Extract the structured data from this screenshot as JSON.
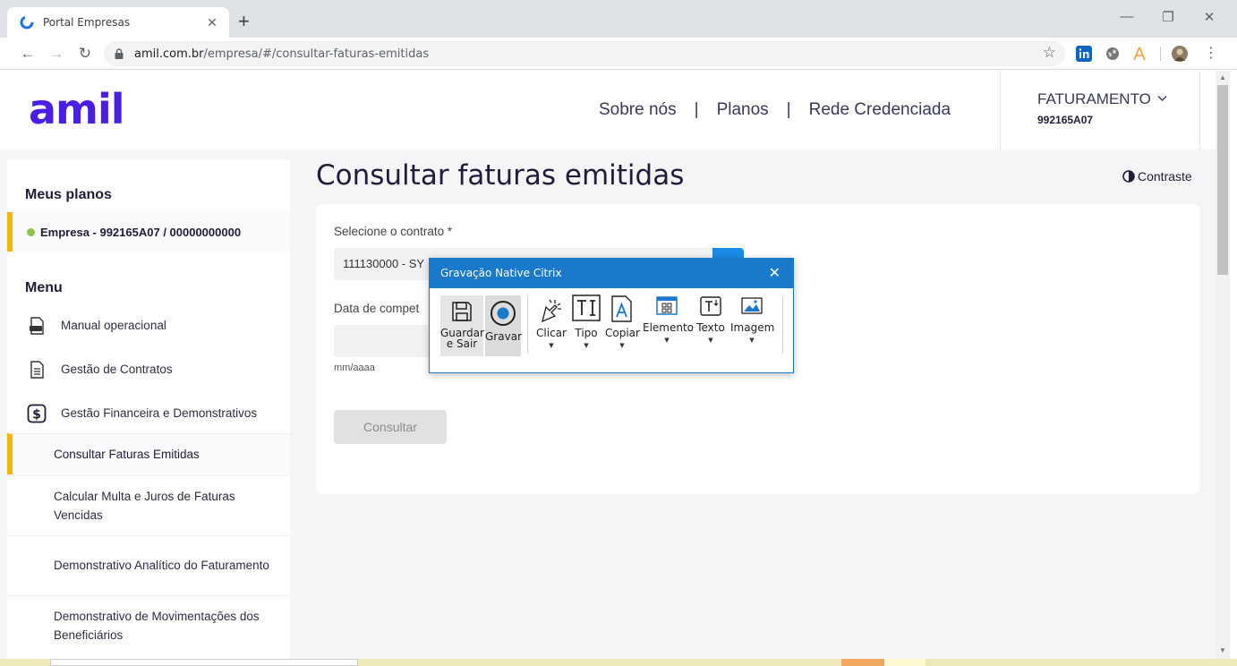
{
  "browser": {
    "tab_title": "Portal Empresas",
    "tab_close": "✕",
    "new_tab": "+",
    "url_host": "amil.com.br",
    "url_path": "/empresa/#/consultar-faturas-emitidas",
    "star": "☆"
  },
  "header": {
    "logo": "amil",
    "nav": [
      "Sobre nós",
      "Planos",
      "Rede Credenciada"
    ],
    "nav_sep": "|",
    "account_label": "FATURAMENTO",
    "account_code": "992165A07"
  },
  "sidebar": {
    "plans_heading": "Meus planos",
    "plan_item": "Empresa - 992165A07 / 00000000000",
    "menu_heading": "Menu",
    "menu_items": [
      {
        "label": "Manual operacional",
        "icon": "pdf-file-icon"
      },
      {
        "label": "Gestão de Contratos",
        "icon": "document-icon"
      },
      {
        "label": "Gestão Financeira e Demonstrativos",
        "icon": "dollar-icon"
      }
    ],
    "sub_items": [
      "Consultar Faturas Emitidas",
      "Calcular Multa e Juros de Faturas Vencidas",
      "Demonstrativo Analítico do Faturamento",
      "Demonstrativo de Movimentações dos Beneficiários"
    ]
  },
  "main": {
    "title": "Consultar faturas emitidas",
    "contrast_label": "Contraste",
    "contract_label": "Selecione o contrato *",
    "contract_value": "111130000 - SY",
    "date_label": "Data de compet",
    "date_hint": "mm/aaaa",
    "consult_button": "Consultar"
  },
  "citrix": {
    "title": "Gravação Native Citrix",
    "close": "✕",
    "tools": [
      {
        "label": "Guardar\ne Sair",
        "icon": "save-icon"
      },
      {
        "label": "Gravar",
        "icon": "record-icon"
      },
      {
        "label": "Clicar",
        "icon": "click-icon"
      },
      {
        "label": "Tipo",
        "icon": "type-icon"
      },
      {
        "label": "Copiar",
        "icon": "copy-icon"
      },
      {
        "label": "Elemento",
        "icon": "element-icon"
      },
      {
        "label": "Texto",
        "icon": "text-icon"
      },
      {
        "label": "Imagem",
        "icon": "image-icon"
      }
    ]
  },
  "colors": {
    "brand": "#4b1ee6",
    "accent_bar": "#f5b400",
    "citrix_blue": "#1979ca"
  }
}
